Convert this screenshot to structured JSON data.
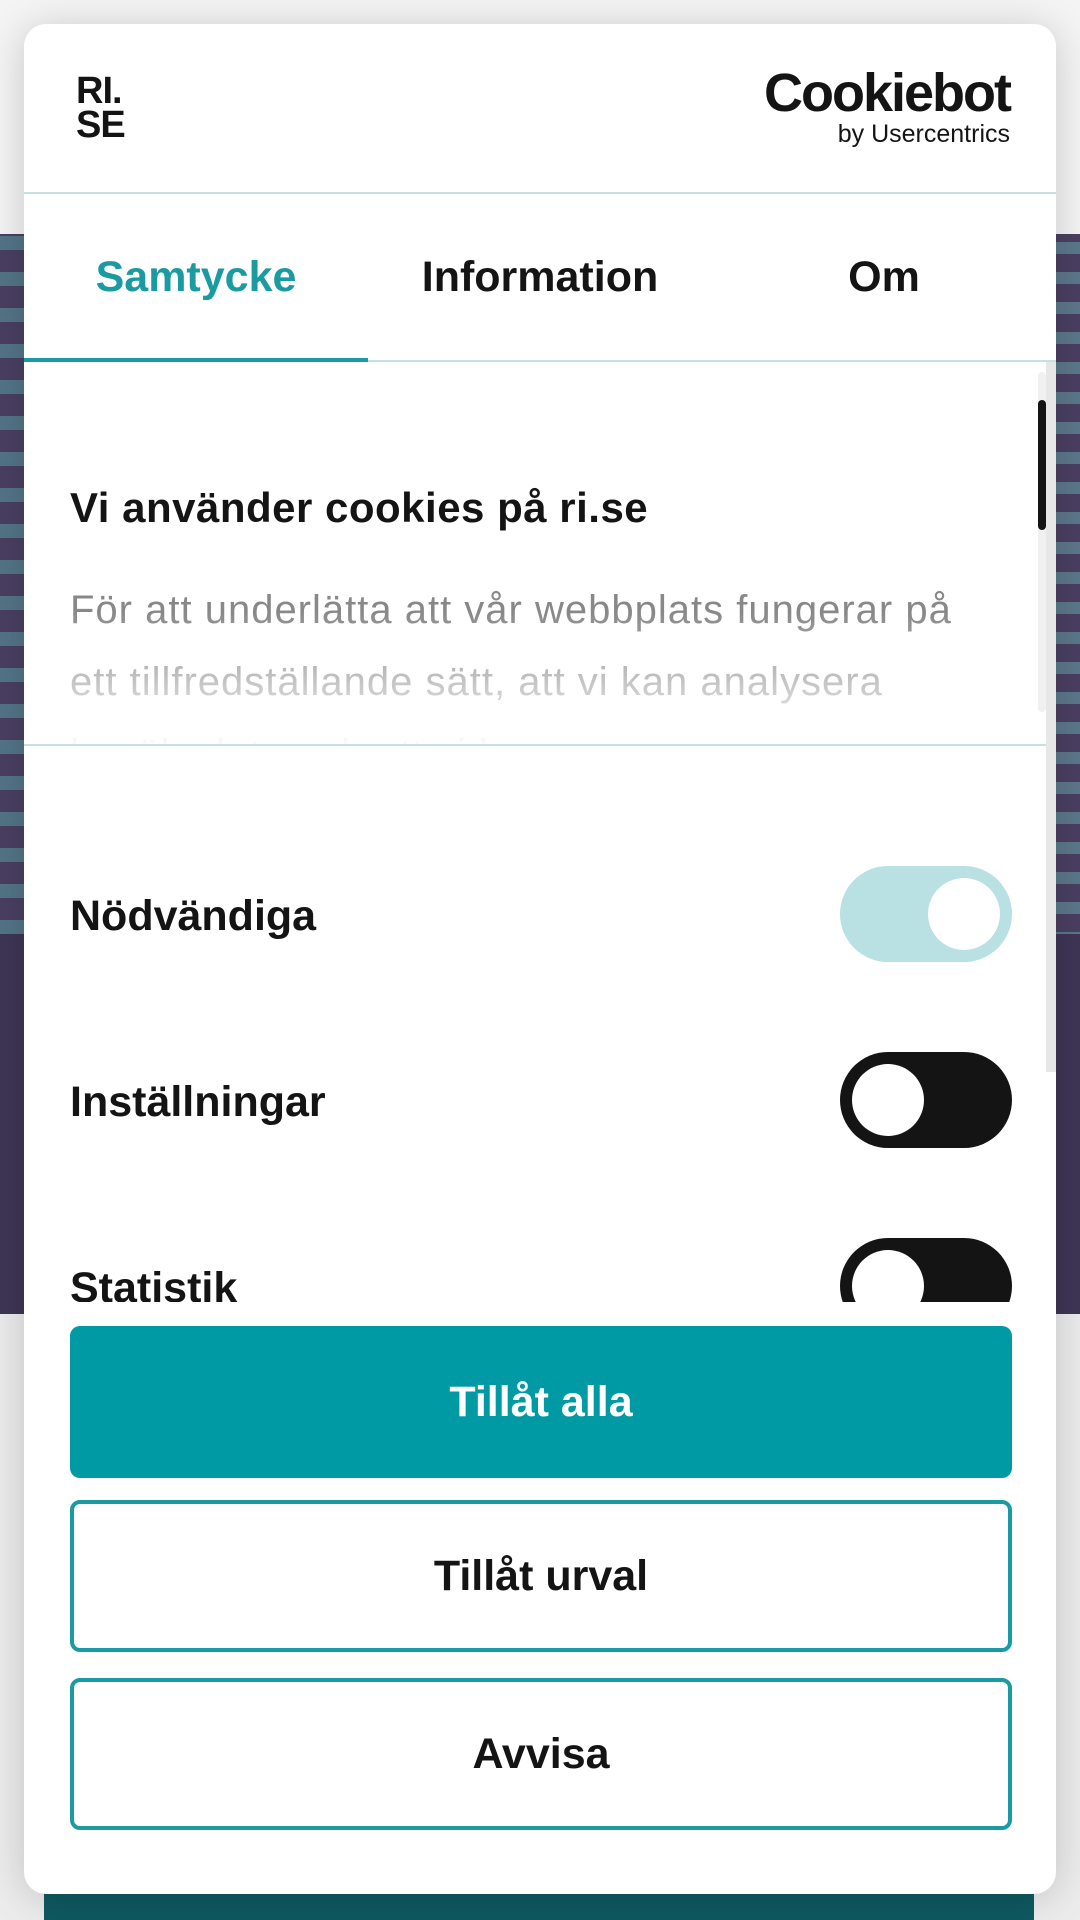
{
  "dialog": {
    "brand_logo_text": [
      "RI.",
      "SE"
    ],
    "cookiebot_logo": {
      "name": "Cookiebot",
      "sub": "by Usercentrics"
    }
  },
  "tabs": [
    {
      "label": "Samtycke",
      "active": true
    },
    {
      "label": "Information",
      "active": false
    },
    {
      "label": "Om",
      "active": false
    }
  ],
  "intro": {
    "title": "Vi använder cookies på ri.se",
    "body": "För att underlätta att vår webbplats fungerar på ett tillfredställande sätt, att vi kan analysera besöksdata och att vi kan"
  },
  "toggles": [
    {
      "label": "Nödvändiga",
      "state": "on",
      "disabled": true
    },
    {
      "label": "Inställningar",
      "state": "off",
      "disabled": false
    },
    {
      "label": "Statistik",
      "state": "off",
      "disabled": false
    }
  ],
  "buttons": {
    "allow_all": "Tillåt alla",
    "allow_selection": "Tillåt urval",
    "decline": "Avvisa"
  },
  "colors": {
    "accent": "#1a9ba2",
    "primary_button": "#009aa4",
    "toggle_on_disabled": "#b9e0e3",
    "toggle_off": "#141414",
    "divider": "#c7e0e4"
  }
}
